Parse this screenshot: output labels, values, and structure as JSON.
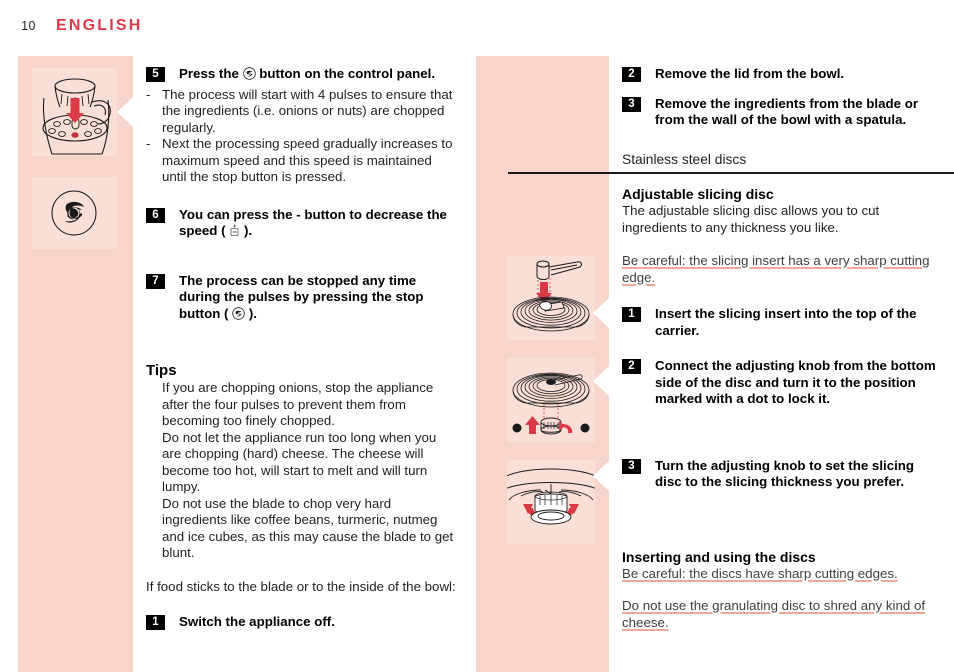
{
  "header": {
    "page_number": "10",
    "language": "ENGLISH",
    "accent_color": "#e0394b"
  },
  "colors": {
    "media_column": "#f7d5ca",
    "figure_panel": "#fadfd7",
    "arrow_red": "#d93a45",
    "warning_underline": "#f0a899",
    "text": "#231f20"
  },
  "left_column": {
    "steps": [
      {
        "number": "5",
        "text_before": "Press the",
        "icon": "pulse-button-icon",
        "text_after": "button on the control panel."
      },
      {
        "number": "6",
        "text_before": "You can press the - button to decrease the speed (",
        "icon": "minus-button-icon",
        "text_after": ")."
      },
      {
        "number": "7",
        "text_before": "The process can be stopped any time during the pulses by pressing the stop button (",
        "icon": "pulse-button-icon",
        "text_after": ")."
      }
    ],
    "dash_items": [
      "The process will start with 4 pulses to ensure that the ingredients (i.e. onions or nuts) are chopped regularly.",
      "Next the processing speed gradually increases to maximum speed and this speed is maintained until the stop button is pressed."
    ],
    "dash_mark": "-",
    "tips_heading": "Tips",
    "tips": [
      "If you are chopping onions, stop the appliance after the four pulses to prevent them from becoming too finely chopped.",
      "Do not let the appliance run too long when you are chopping (hard) cheese. The cheese will become too hot, will start to melt and will turn lumpy.",
      "Do not use the blade to chop very hard ingredients like coffee beans, turmeric, nutmeg and ice cubes, as this may cause the blade to get blunt."
    ],
    "food_sticks_text": "If food sticks to the blade or to the inside of the bowl:",
    "final_step": {
      "number": "1",
      "text": "Switch the appliance off."
    }
  },
  "right_column": {
    "steps_top": [
      {
        "number": "2",
        "text": "Remove the lid from the bowl."
      },
      {
        "number": "3",
        "text": "Remove the ingredients from the blade or from the wall of the bowl with a spatula."
      }
    ],
    "section_heading": "Stainless steel discs",
    "sub_heading_1": "Adjustable slicing disc",
    "sub_intro_1": "The adjustable slicing disc allows you to cut ingredients to any thickness you like.",
    "warning_1": "Be careful: the slicing insert has a very sharp cutting edge.",
    "steps_disc": [
      {
        "number": "1",
        "text": "Insert the slicing insert into the top of the carrier."
      },
      {
        "number": "2",
        "text": "Connect the adjusting knob from the bottom side of the disc and turn it to the position marked with a dot to lock it."
      },
      {
        "number": "3",
        "text": "Turn the adjusting knob to set the slicing disc to the slicing thickness you prefer."
      }
    ],
    "sub_heading_2": "Inserting and using the discs",
    "warning_2": "Be careful: the discs have sharp cutting edges.",
    "warning_3": "Do not use the granulating disc to shred any kind of cheese."
  },
  "figures": [
    {
      "name": "bowl-press-button-illustration"
    },
    {
      "name": "pulse-button-closeup-illustration"
    },
    {
      "name": "slicing-insert-into-carrier-illustration"
    },
    {
      "name": "adjusting-knob-bottom-illustration"
    },
    {
      "name": "turn-adjusting-knob-illustration"
    }
  ]
}
